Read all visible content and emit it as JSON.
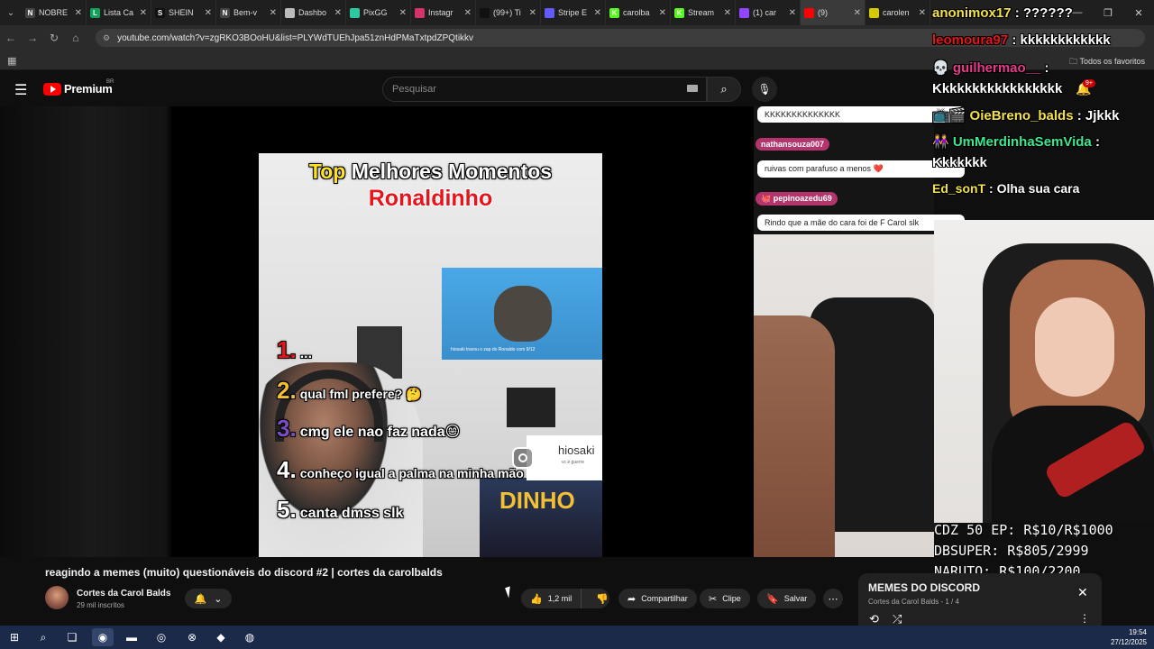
{
  "browser": {
    "tabs": [
      {
        "label": "NOBRE",
        "icon_color": "#444444",
        "glyph": "N"
      },
      {
        "label": "Lista Ca",
        "icon_color": "#12a15c",
        "glyph": "L"
      },
      {
        "label": "SHEIN",
        "icon_color": "#111111",
        "glyph": "S"
      },
      {
        "label": "Bem-v",
        "icon_color": "#444444",
        "glyph": "N"
      },
      {
        "label": "Dashbo",
        "icon_color": "#bbbbbb",
        "glyph": ""
      },
      {
        "label": "PixGG",
        "icon_color": "#2dc7a0",
        "glyph": ""
      },
      {
        "label": "Instagr",
        "icon_color": "#d6336c",
        "glyph": ""
      },
      {
        "label": "(99+) Ti",
        "icon_color": "#111111",
        "glyph": ""
      },
      {
        "label": "Stripe E",
        "icon_color": "#635bff",
        "glyph": ""
      },
      {
        "label": "carolba",
        "icon_color": "#53fc18",
        "glyph": "K"
      },
      {
        "label": "Stream",
        "icon_color": "#53fc18",
        "glyph": "K"
      },
      {
        "label": "(1) car",
        "icon_color": "#9146ff",
        "glyph": ""
      },
      {
        "label": "(9)",
        "icon_color": "#ff0000",
        "glyph": "",
        "active": true
      },
      {
        "label": "carolen",
        "icon_color": "#d4c800",
        "glyph": ""
      }
    ],
    "url": "youtube.com/watch?v=zgRKO3BOoHU&list=PLYWdTUEhJpa51znHdPMaTxtpdZPQtikkv",
    "bookmarks_all": "Todos os favoritos"
  },
  "youtube": {
    "brand": "Premium",
    "country": "BR",
    "search_placeholder": "Pesquisar",
    "notif_count": "9+"
  },
  "meme": {
    "title_top": "Top",
    "title_rest": " Melhores Momentos",
    "subtitle": "Ronaldinho",
    "rat_caption": "hiosaki travou o zap do Ronaldo com 9/12",
    "hiosaki": "hiosaki",
    "hiosaki_sub": "vc é guerre",
    "dinho": "DINHO",
    "items": [
      {
        "n": "1.",
        "text": "..."
      },
      {
        "n": "2.",
        "text": "qual fml prefere? 🤔"
      },
      {
        "n": "3.",
        "text": "cmg ele nao faz nada😊"
      },
      {
        "n": "4.",
        "text": "conheço igual a palma na minha mão"
      },
      {
        "n": "5.",
        "text": "canta dmss slk"
      }
    ]
  },
  "stream_chat": [
    {
      "user": "",
      "msg": "KKKKKKKKKKKKKK"
    },
    {
      "user": "nathansouza007",
      "msg": "ruivas com parafuso a menos ❤️"
    },
    {
      "user": "🐙 pepinoazedu69",
      "msg": "Rindo que a mãe do cara foi de F Carol slk"
    }
  ],
  "twitch_overlay": [
    {
      "user": "anonimox17",
      "msg": " : ??????",
      "color": "#f3e24a"
    },
    {
      "user": "leomoura97",
      "msg": " : kkkkkkkkkkkk",
      "color": "#e8141b"
    },
    {
      "user": "💀 guilhermao__",
      "msg": " :",
      "color": "#e83a8a"
    },
    {
      "user": "",
      "msg": "Kkkkkkkkkkkkkkkkk",
      "color": "#ffffff"
    },
    {
      "user": "📺🎬 OieBreno_balds",
      "msg": " : Jjkkk",
      "color": "#f3e24a"
    },
    {
      "user": "👭 UmMerdinhaSemVida",
      "msg": " :",
      "color": "#3de890"
    },
    {
      "user": "",
      "msg": "Kkkkkkk",
      "color": "#ffffff"
    },
    {
      "user": "Ed_sonT",
      "msg": " : Olha sua cara",
      "color": "#f3e24a"
    }
  ],
  "promo": [
    "CDZ 50 EP: R$10/R$1000",
    "DBSUPER: R$805/2999",
    "NARUTO: R$100/2200"
  ],
  "video": {
    "title": "reagindo a memes (muito) questionáveis do discord #2 | cortes da carolbalds",
    "channel": "Cortes da Carol Balds",
    "subs": "29 mil inscritos",
    "likes": "1,2 mil",
    "share": "Compartilhar",
    "clip": "Clipe",
    "save": "Salvar"
  },
  "playlist": {
    "title": "MEMES DO DISCORD",
    "channel": "Cortes da Carol Balds",
    "position": "1 / 4"
  },
  "system": {
    "time": "19:54",
    "date": "27/12/2025"
  }
}
